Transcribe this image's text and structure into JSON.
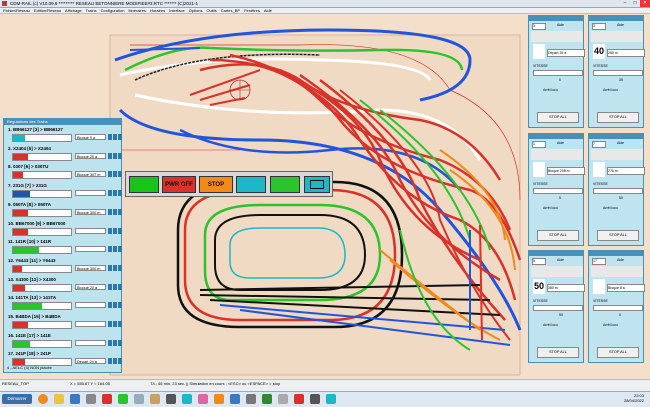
{
  "window": {
    "title": "CDM-RAIL (c) V10.09.9 ********* RESEAU BETONNIERE MODIFIEE#3.RTC ******* (C)2021-1"
  },
  "menu": [
    "Fichier/Réseau",
    "Edition/Réseau",
    "Affichage",
    "Trains",
    "Configuration",
    "Itinéraires",
    "Horaires",
    "Interface",
    "Options",
    "Outils",
    "Cartes_BP",
    "Fenêtres",
    "Aide"
  ],
  "registry": {
    "title": "Régulations des Trains",
    "footer": "4 - AELC (4) NON placée",
    "locos": [
      {
        "label": "1. BB66127 [3] > BB66127",
        "status": "Bloqué  9 a",
        "fill": 0.2,
        "fill_color": "#1db8c8"
      },
      {
        "label": "2. X2404 [5] > X2404",
        "status": "Bloqué 20 a",
        "fill": 0.25,
        "fill_color": "#d8322a"
      },
      {
        "label": "8. 0307 [6] > 030TU",
        "status": "Bloqué 307 m",
        "fill": 0.18,
        "fill_color": "#d8322a"
      },
      {
        "label": "7. 231G [7] > 231G",
        "status": "",
        "fill": 0.3,
        "fill_color": "#2255aa"
      },
      {
        "label": "9. 050TA [8] > 050TA",
        "status": "Bloqué 300 m",
        "fill": 0.25,
        "fill_color": "#d8322a"
      },
      {
        "label": "10. BB67000 [9] > BB67000",
        "status": "",
        "fill": 0.25,
        "fill_color": "#d8322a"
      },
      {
        "label": "11. 141R [10] > 141R",
        "status": "",
        "fill": 0.45,
        "fill_color": "#2cc42c"
      },
      {
        "label": "12. Y6443 [11] > Y6443",
        "status": "Bloqué 300 m",
        "fill": 0.15,
        "fill_color": "#d8322a"
      },
      {
        "label": "13. X4300 [12] > X4300",
        "status": "Bloqué 20 a",
        "fill": 0.2,
        "fill_color": "#d8322a"
      },
      {
        "label": "14. 141TA [13] > 141TA",
        "status": "",
        "fill": 0.5,
        "fill_color": "#2cc42c"
      },
      {
        "label": "15. B4BDA [15] > B4BDA",
        "status": "",
        "fill": 0.25,
        "fill_color": "#d8322a"
      },
      {
        "label": "16. 141E [17] > 141E",
        "status": "",
        "fill": 0.3,
        "fill_color": "#2cc42c"
      },
      {
        "label": "17. 241P [18] > 241P",
        "status": "Départ 24 a",
        "fill": 0.2,
        "fill_color": "#d8322a"
      }
    ]
  },
  "toolbar": {
    "pwr_off": "PWR OFF",
    "stop": "STOP",
    "colors": {
      "green": "#19c419",
      "red": "#d8322a",
      "orange": "#f08a1a",
      "teal": "#1db8c8",
      "dark": "#2b2b2b"
    }
  },
  "cabs": [
    {
      "addr": "3",
      "speed": "",
      "block": "Départ 34 a",
      "kmh": "0"
    },
    {
      "addr": "3",
      "speed": "40",
      "block": "280 m",
      "kmh": "35"
    },
    {
      "addr": "1",
      "speed": "",
      "block": "Bloqué 208 m",
      "kmh": "5"
    },
    {
      "addr": "7",
      "speed": "",
      "block": "276 m",
      "kmh": "50"
    },
    {
      "addr": "5",
      "speed": "50",
      "block": "380 m",
      "kmh": "50"
    },
    {
      "addr": "17",
      "speed": "",
      "block": "Bloqué 8 a",
      "kmh": "0"
    }
  ],
  "cab_labels": {
    "aide": "Aide",
    "vitesse": "VITESSE",
    "stop_all": "STOP ALL",
    "arret": "Arrêt loco"
  },
  "status": {
    "left": "RESEAU_TOP",
    "coords": "X = 555.87     Y = 164.05",
    "message": "T/L: 46 min. 23 sec. || Simulation en cours : <ESC> ou <ESPACE> = stop"
  },
  "taskbar": {
    "start": "Démarrer",
    "time": "22:03",
    "date": "28/04/2022"
  }
}
